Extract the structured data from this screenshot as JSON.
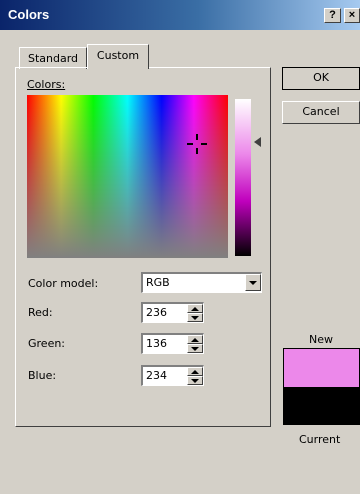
{
  "window": {
    "title": "Colors",
    "help_button": "?",
    "close_button": "×"
  },
  "tabs": [
    {
      "label": "Standard",
      "selected": false
    },
    {
      "label": "Custom",
      "selected": true
    }
  ],
  "custom": {
    "colors_label": "Colors:",
    "color_model": {
      "label": "Color model:",
      "value": "RGB"
    },
    "red": {
      "label": "Red:",
      "value": "236"
    },
    "green": {
      "label": "Green:",
      "value": "136"
    },
    "blue": {
      "label": "Blue:",
      "value": "234"
    }
  },
  "buttons": {
    "ok": "OK",
    "cancel": "Cancel"
  },
  "preview": {
    "new_label": "New",
    "current_label": "Current",
    "new_color": "#ec88ea",
    "current_color": "#000000"
  },
  "colors": {
    "titlebar_start": "#0a246a",
    "titlebar_end": "#a6caf0",
    "dialog_face": "#d4d0c8"
  }
}
